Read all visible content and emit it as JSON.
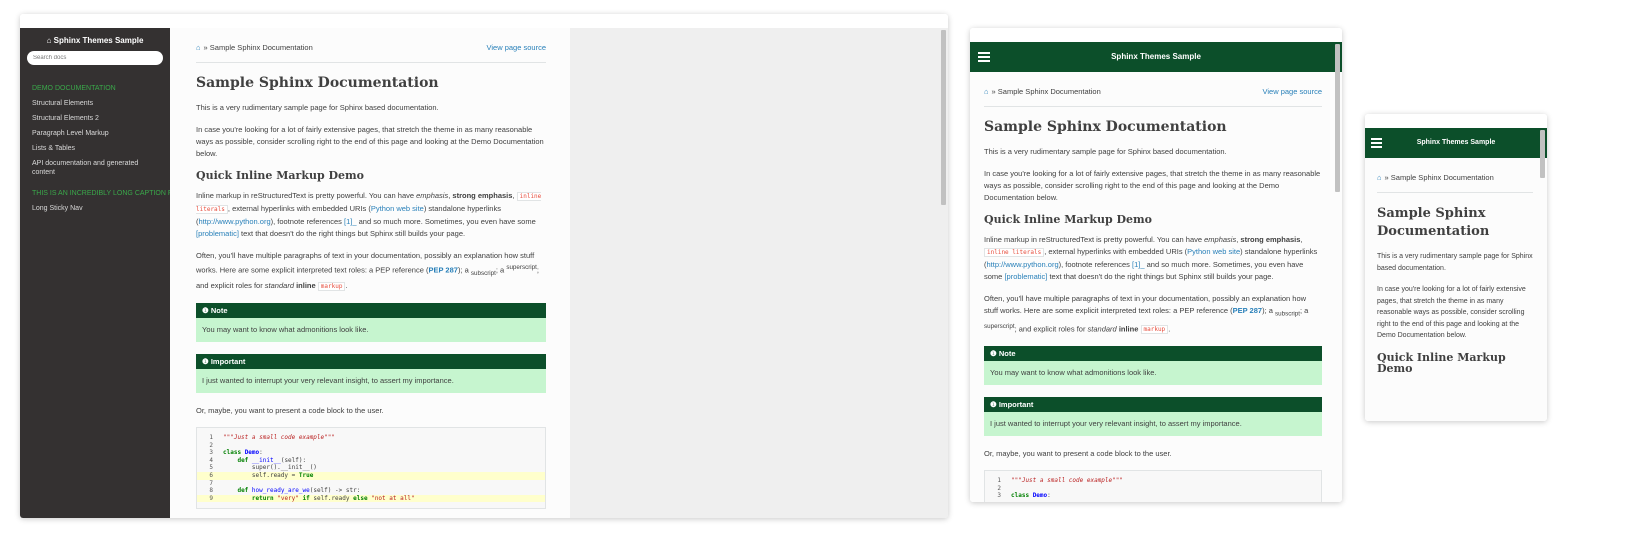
{
  "site_title": "Sphinx Themes Sample",
  "search_placeholder": "Search docs",
  "nav_caption": "DEMO DOCUMENTATION",
  "nav_items": [
    "Structural Elements",
    "Structural Elements 2",
    "Paragraph Level Markup",
    "Lists & Tables",
    "API documentation and generated content"
  ],
  "nav_caption2": "THIS IS AN INCREDIBLY LONG CAPTION FOR A NAV",
  "nav_items2": [
    "Long Sticky Nav"
  ],
  "breadcrumb": {
    "sep": "»",
    "current": "Sample Sphinx Documentation",
    "source": "View page source"
  },
  "title": "Sample Sphinx Documentation",
  "intro": "This is a very rudimentary sample page for Sphinx based documentation.",
  "intro2": "In case you're looking for a lot of fairly extensive pages, that stretch the theme in as many reasonable ways as possible, consider scrolling right to the end of this page and looking at the Demo Documentation below.",
  "h2": "Quick Inline Markup Demo",
  "p1": {
    "a": "Inline markup in reStructuredText is pretty powerful. You can have ",
    "emph": "emphasis",
    "b": ", ",
    "strong": "strong emphasis",
    "c": ",",
    "lit": "inline literals",
    "d": ", external hyperlinks with embedded URIs (",
    "link1": "Python web site",
    "e": ") standalone hyperlinks (",
    "link2": "http://www.python.org",
    "f": "), footnote references ",
    "fn": "[1]_",
    "g": " and so much more. Sometimes, you even have some ",
    "prob": "[problematic]",
    "h": " text that doesn't do the right things but Sphinx still builds your page."
  },
  "p2": {
    "a": "Often, you'll have multiple paragraphs of text in your documentation, possibly an explanation how stuff works. Here are some explicit interpreted text roles: a PEP reference (",
    "pep": "PEP 287",
    "b": "); a ",
    "sub": "subscript",
    "c": "; a ",
    "sup": "superscript",
    "d": "; and explicit roles for ",
    "std": "standard",
    "inl": "inline",
    "lit": "markup",
    "e": "."
  },
  "note": {
    "title": "Note",
    "body": "You may want to know what admonitions look like."
  },
  "important": {
    "title": "Important",
    "body": "I just wanted to interrupt your very relevant insight, to assert my importance."
  },
  "p3": "Or, maybe, you want to present a code block to the user.",
  "code": [
    {
      "n": "1",
      "t": "\"\"\"Just a small code example\"\"\""
    },
    {
      "n": "2",
      "t": ""
    },
    {
      "n": "3",
      "t": "class Demo:"
    },
    {
      "n": "4",
      "t": "    def __init__(self):"
    },
    {
      "n": "5",
      "t": "        super().__init__()"
    },
    {
      "n": "6",
      "t": "        self.ready = True"
    },
    {
      "n": "7",
      "t": ""
    },
    {
      "n": "8",
      "t": "    def how_ready_are_we(self) -> str:"
    },
    {
      "n": "9",
      "t": "        return \"very\" if self.ready else \"not at all\""
    }
  ],
  "colors": {
    "brand": "#0c4f2a",
    "admonition_bg": "#c6f5cf",
    "link": "#2980b9",
    "sidebar": "#343131"
  }
}
